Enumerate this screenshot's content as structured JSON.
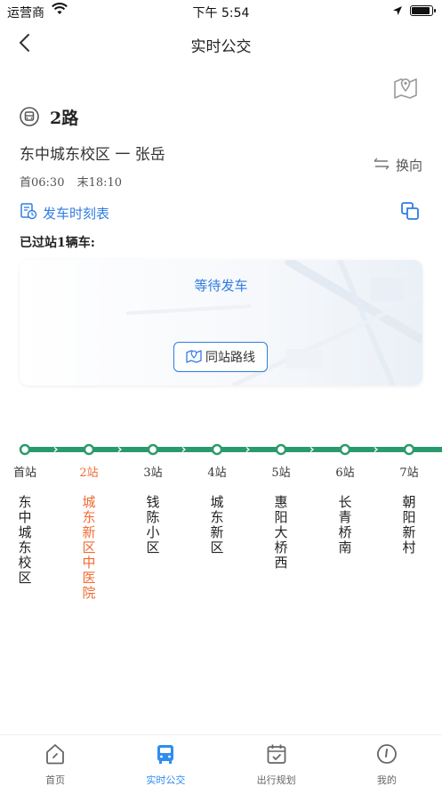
{
  "status": {
    "carrier": "运营商",
    "time": "下午 5:54"
  },
  "nav": {
    "title": "实时公交"
  },
  "route": {
    "name": "2路",
    "direction": "东中城东校区 一 张岳",
    "switch_label": "换向",
    "first_bus": "首06:30",
    "last_bus": "末18:10",
    "timetable_label": "发车时刻表",
    "passed_label": "已过站1辆车:"
  },
  "card": {
    "waiting_text": "等待发车",
    "same_stop_label": "同站路线"
  },
  "stops": [
    {
      "num": "首站",
      "name": "东中城东校区"
    },
    {
      "num": "2站",
      "name": "城东新区中医院",
      "current": true
    },
    {
      "num": "3站",
      "name": "钱陈小区"
    },
    {
      "num": "4站",
      "name": "城东新区"
    },
    {
      "num": "5站",
      "name": "惠阳大桥西"
    },
    {
      "num": "6站",
      "name": "长青桥南"
    },
    {
      "num": "7站",
      "name": "朝阳新村"
    }
  ],
  "tabs": [
    {
      "label": "首页",
      "icon": "home-icon"
    },
    {
      "label": "实时公交",
      "icon": "bus-icon",
      "active": true
    },
    {
      "label": "出行规划",
      "icon": "calendar-icon"
    },
    {
      "label": "我的",
      "icon": "profile-icon"
    }
  ],
  "colors": {
    "accent": "#2f7de1",
    "line": "#2a9a6c",
    "current_stop": "#f06a32",
    "tab_active": "#2f8cf0"
  }
}
